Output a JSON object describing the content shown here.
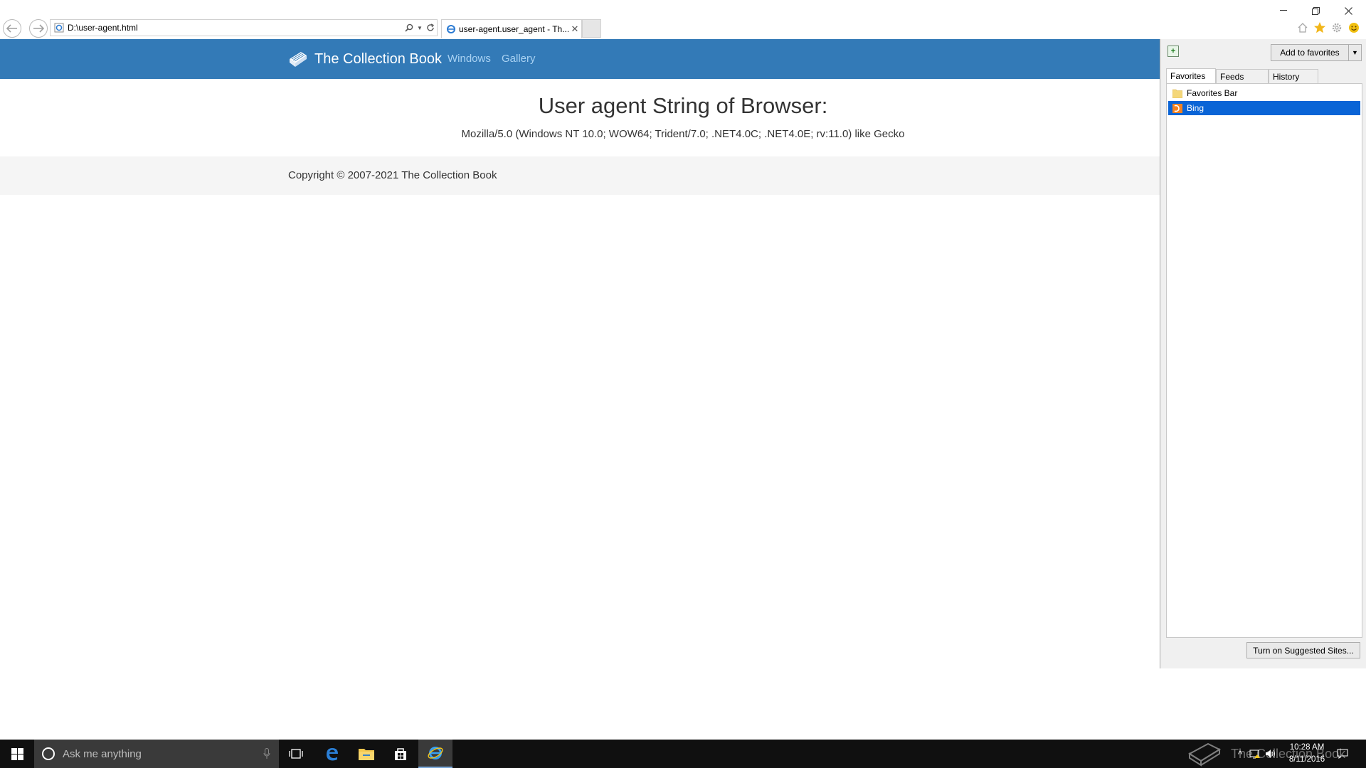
{
  "browser": {
    "address": "D:\\user-agent.html",
    "tab_title": "user-agent.user_agent - Th...",
    "colors": {
      "accent": "#337ab7",
      "selection": "#0a64d6"
    }
  },
  "page": {
    "brand": "The Collection Book",
    "nav_links": [
      "Windows",
      "Gallery"
    ],
    "heading": "User agent String of Browser:",
    "user_agent": "Mozilla/5.0 (Windows NT 10.0; WOW64; Trident/7.0; .NET4.0C; .NET4.0E; rv:11.0) like Gecko",
    "footer": "Copyright © 2007-2021 The Collection Book"
  },
  "favorites_pane": {
    "add_button": "Add to favorites",
    "tabs": [
      "Favorites",
      "Feeds",
      "History"
    ],
    "active_tab": "Favorites",
    "items": [
      {
        "label": "Favorites Bar",
        "icon": "folder-icon"
      },
      {
        "label": "Bing",
        "icon": "bing-icon",
        "selected": true
      }
    ],
    "suggested_button": "Turn on Suggested Sites..."
  },
  "taskbar": {
    "search_placeholder": "Ask me anything",
    "time": "10:28 AM",
    "date": "8/11/2016",
    "watermark": "The Collection Book"
  }
}
